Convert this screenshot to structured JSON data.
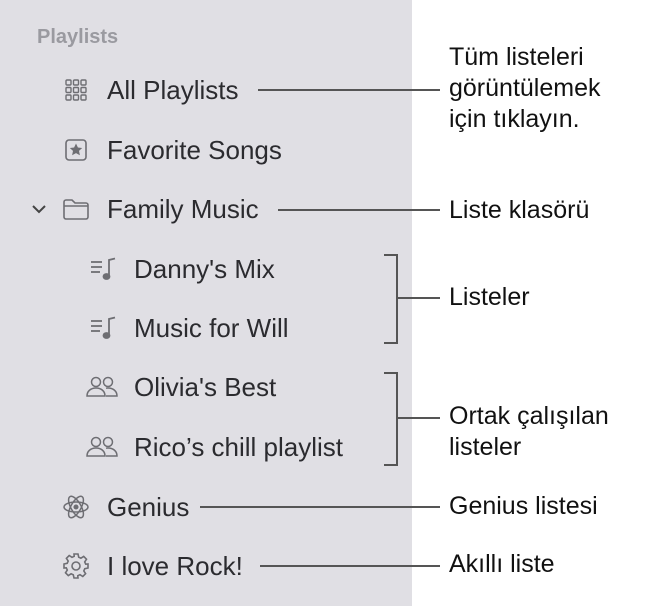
{
  "sidebar": {
    "section_title": "Playlists",
    "items": [
      {
        "label": "All Playlists",
        "icon": "grid-icon"
      },
      {
        "label": "Favorite Songs",
        "icon": "star-icon"
      },
      {
        "label": "Family Music",
        "icon": "folder-icon"
      },
      {
        "label": "Danny's Mix",
        "icon": "playlist-icon"
      },
      {
        "label": "Music for Will",
        "icon": "playlist-icon"
      },
      {
        "label": "Olivia's Best",
        "icon": "people-icon"
      },
      {
        "label": "Rico’s chill playlist",
        "icon": "people-icon"
      },
      {
        "label": "Genius",
        "icon": "atom-icon"
      },
      {
        "label": "I love Rock!",
        "icon": "gear-icon"
      }
    ]
  },
  "callouts": {
    "all_playlists_line1": "Tüm listeleri",
    "all_playlists_line2": "görüntülemek",
    "all_playlists_line3": "için tıklayın.",
    "folder": "Liste klasörü",
    "playlists": "Listeler",
    "shared_line1": "Ortak çalışılan",
    "shared_line2": "listeler",
    "genius": "Genius listesi",
    "smart": "Akıllı liste"
  },
  "colors": {
    "sidebar_bg": "#e0dfe4",
    "section_title": "#9a9aa0",
    "icon": "#6e6e73",
    "callout_line": "#555555"
  }
}
